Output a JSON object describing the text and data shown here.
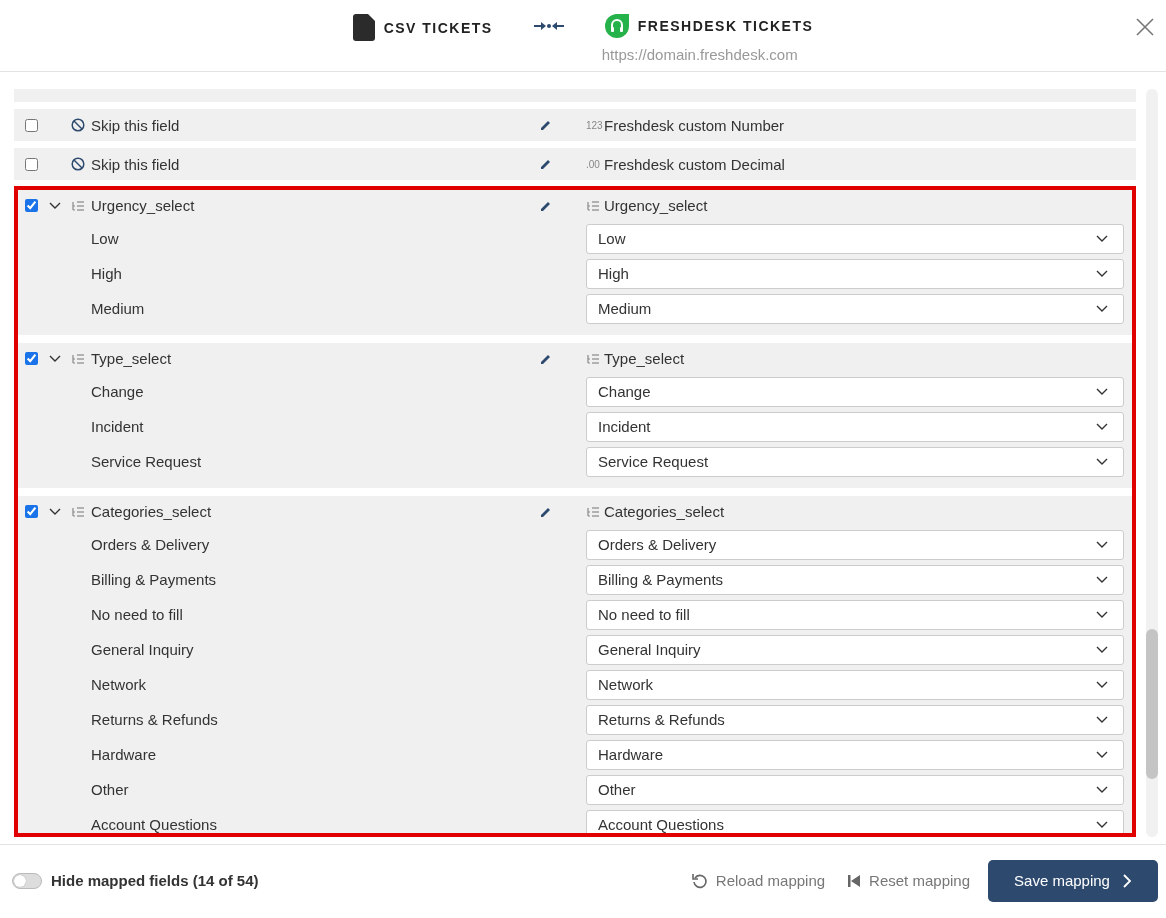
{
  "header": {
    "source": {
      "label": "CSV TICKETS"
    },
    "target": {
      "label": "FRESHDESK TICKETS",
      "url": "https://domain.freshdesk.com"
    }
  },
  "rows": [
    {
      "kind": "skip",
      "highlighted": false,
      "checked": false,
      "source": "Skip this field",
      "target": {
        "kind": "number",
        "badge": "123",
        "label": "Freshdesk custom Number"
      }
    },
    {
      "kind": "skip",
      "highlighted": false,
      "checked": false,
      "source": "Skip this field",
      "target": {
        "kind": "decimal",
        "badge": ".00",
        "label": "Freshdesk custom Decimal"
      }
    },
    {
      "kind": "select",
      "highlighted": true,
      "checked": true,
      "expanded": true,
      "source": "Urgency_select",
      "target": {
        "kind": "list",
        "label": "Urgency_select"
      },
      "options": [
        {
          "source": "Low",
          "value": "Low"
        },
        {
          "source": "High",
          "value": "High"
        },
        {
          "source": "Medium",
          "value": "Medium"
        }
      ]
    },
    {
      "kind": "select",
      "highlighted": true,
      "checked": true,
      "expanded": true,
      "source": "Type_select",
      "target": {
        "kind": "list",
        "label": "Type_select"
      },
      "options": [
        {
          "source": "Change",
          "value": "Change"
        },
        {
          "source": "Incident",
          "value": "Incident"
        },
        {
          "source": "Service Request",
          "value": "Service Request"
        }
      ]
    },
    {
      "kind": "select",
      "highlighted": true,
      "checked": true,
      "expanded": true,
      "source": "Categories_select",
      "target": {
        "kind": "list",
        "label": "Categories_select"
      },
      "options": [
        {
          "source": "Orders & Delivery",
          "value": "Orders & Delivery"
        },
        {
          "source": "Billing & Payments",
          "value": "Billing & Payments"
        },
        {
          "source": "No need to fill",
          "value": "No need to fill"
        },
        {
          "source": "General Inquiry",
          "value": "General Inquiry"
        },
        {
          "source": "Network",
          "value": "Network"
        },
        {
          "source": "Returns & Refunds",
          "value": "Returns & Refunds"
        },
        {
          "source": "Hardware",
          "value": "Hardware"
        },
        {
          "source": "Other",
          "value": "Other"
        },
        {
          "source": "Account Questions",
          "value": "Account Questions"
        }
      ]
    }
  ],
  "footer": {
    "hide_mapped": {
      "label": "Hide mapped fields (14 of 54)",
      "on": false
    },
    "actions": [
      {
        "kind": "reload",
        "label": "Reload mapping"
      },
      {
        "kind": "reset",
        "label": "Reset mapping"
      },
      {
        "kind": "primary",
        "label": "Save mapping"
      }
    ]
  }
}
